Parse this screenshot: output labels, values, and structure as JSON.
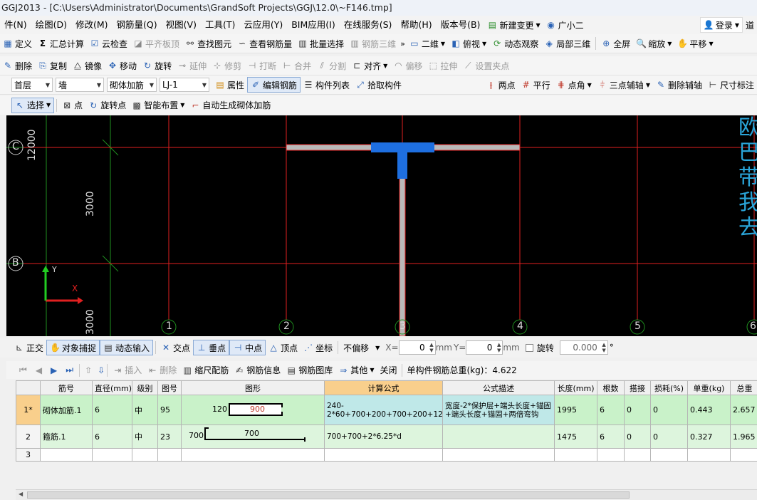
{
  "window": {
    "title": "GGJ2013 - [C:\\Users\\Administrator\\Documents\\GrandSoft Projects\\GGJ\\12.0\\~F146.tmp]"
  },
  "menu": {
    "items": [
      "件(N)",
      "绘图(D)",
      "修改(M)",
      "钢筋量(Q)",
      "视图(V)",
      "工具(T)",
      "云应用(Y)",
      "BIM应用(I)",
      "在线服务(S)",
      "帮助(H)",
      "版本号(B)"
    ],
    "new_change": "新建变更",
    "assistant": "广小二",
    "login": "登录",
    "extra": "道"
  },
  "toolbar1": {
    "define": "定义",
    "sum_calc": "汇总计算",
    "cloud_check": "云检查",
    "flat_slab": "平齐板顶",
    "find_elem": "查找图元",
    "view_rebar": "查看钢筋量",
    "batch_select": "批量选择",
    "rebar_3d": "钢筋三维",
    "view2d": "二维",
    "top_view": "俯视",
    "dynamic_view": "动态观察",
    "local_3d": "局部三维",
    "fullscreen": "全屏",
    "zoom": "缩放",
    "pan": "平移"
  },
  "toolbar2": {
    "delete": "删除",
    "copy": "复制",
    "mirror": "镜像",
    "move": "移动",
    "rotate": "旋转",
    "extend": "延伸",
    "trim": "修剪",
    "break": "打断",
    "merge": "合并",
    "split": "分割",
    "align": "对齐",
    "offset": "偏移",
    "stretch": "拉伸",
    "set_grip": "设置夹点"
  },
  "toolbar3": {
    "floor": "首层",
    "category": "墙",
    "type": "砌体加筋",
    "element": "LJ-1",
    "property": "属性",
    "edit_rebar": "编辑钢筋",
    "component_list": "构件列表",
    "pick_component": "拾取构件",
    "two_points": "两点",
    "parallel": "平行",
    "point_angle": "点角",
    "three_point_axis": "三点辅轴",
    "delete_axis": "删除辅轴",
    "dimension": "尺寸标注"
  },
  "toolbar4": {
    "select": "选择",
    "point": "点",
    "rotate_point": "旋转点",
    "smart_layout": "智能布置",
    "auto_gen": "自动生成砌体加筋"
  },
  "canvas": {
    "axis_rows": [
      "C",
      "B"
    ],
    "axis_cols": [
      "1",
      "2",
      "3",
      "4",
      "5",
      "6"
    ],
    "dims": [
      "12000",
      "3000",
      "3000"
    ],
    "ucs_x": "X",
    "ucs_y": "Y",
    "overlay_chars": [
      "欧",
      "巴",
      "带",
      "我",
      "去"
    ]
  },
  "snapbar": {
    "ortho": "正交",
    "obj_snap": "对象捕捉",
    "dyn_input": "动态输入",
    "intersection": "交点",
    "perpendicular": "垂点",
    "midpoint": "中点",
    "vertex": "顶点",
    "coordinate": "坐标",
    "offset_mode": "不偏移",
    "x_label": "X=",
    "x_value": "0",
    "y_label": "Y=",
    "y_value": "0",
    "unit": "mm",
    "rotate_label": "旋转",
    "rotate_value": "0.000",
    "degree": "°"
  },
  "panel": {
    "insert": "插入",
    "delete": "删除",
    "scale_rebar": "缩尺配筋",
    "rebar_info": "钢筋信息",
    "rebar_library": "钢筋图库",
    "other": "其他",
    "close": "关闭",
    "total_weight": "单构件钢筋总重(kg)：4.622"
  },
  "table": {
    "headers": [
      "筋号",
      "直径(mm)",
      "级别",
      "图号",
      "图形",
      "计算公式",
      "公式描述",
      "长度(mm)",
      "根数",
      "搭接",
      "损耗(%)",
      "单重(kg)",
      "总重"
    ],
    "rows": [
      {
        "num": "1*",
        "name": "砌体加筋.1",
        "diameter": "6",
        "grade": "中",
        "shape_no": "95",
        "shape_left": "120",
        "shape_mid": "900",
        "formula": "240-2*60+700+200+700+200+12.5*d",
        "desc": "宽度-2*保护层+端头长度+锚固+端头长度+锚固+两倍弯钩",
        "length": "1995",
        "count": "6",
        "lap": "0",
        "loss": "0",
        "unit_weight": "0.443",
        "total_weight": "2.657"
      },
      {
        "num": "2",
        "name": "箍筋.1",
        "diameter": "6",
        "grade": "中",
        "shape_no": "23",
        "shape_left": "700",
        "shape_mid": "700",
        "formula": "700+700+2*6.25*d",
        "desc": "",
        "length": "1475",
        "count": "6",
        "lap": "0",
        "loss": "0",
        "unit_weight": "0.327",
        "total_weight": "1.965"
      },
      {
        "num": "3"
      }
    ]
  },
  "colors": {
    "canvas_bg": "#000000",
    "grid_red": "#e02020",
    "wall_blue": "#1e6fe0",
    "row_green": "#c9f2c9",
    "header_orange": "#f9cf8c"
  }
}
